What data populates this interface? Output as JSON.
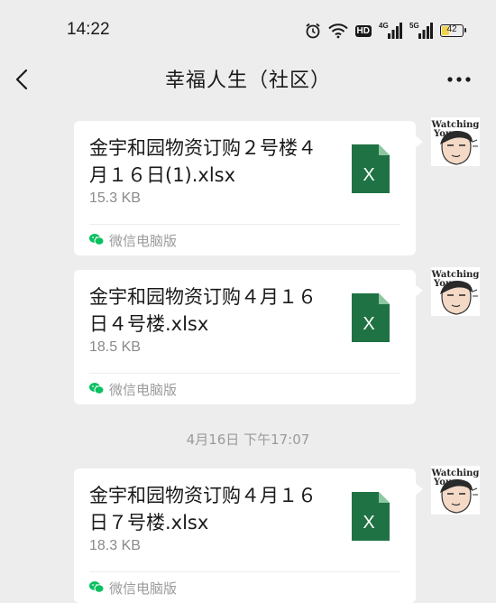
{
  "status_bar": {
    "time": "14:22",
    "hd_label": "HD",
    "net1_label": "4G",
    "net2_label": "5G",
    "battery_level": "42"
  },
  "nav": {
    "title": "幸福人生（社区）",
    "back_icon": "chevron-left-icon",
    "more_icon": "ellipsis-icon"
  },
  "messages": [
    {
      "file_name": "金宇和园物资订购２号楼４月１６日(1).xlsx",
      "file_size": "15.3 KB",
      "source": "微信电脑版"
    },
    {
      "file_name": "金宇和园物资订购４月１６日４号楼.xlsx",
      "file_size": "18.5 KB",
      "source": "微信电脑版"
    },
    {
      "file_name": "金宇和园物资订购４月１６日７号楼.xlsx",
      "file_size": "18.3 KB",
      "source": "微信电脑版"
    }
  ],
  "date_separator": "4月16日 下午17:07",
  "file_icon_letter": "X",
  "avatar_text": [
    "Watching",
    "You"
  ],
  "colors": {
    "background": "#ededed",
    "excel_green": "#1f7244",
    "wechat_green": "#07c160"
  }
}
